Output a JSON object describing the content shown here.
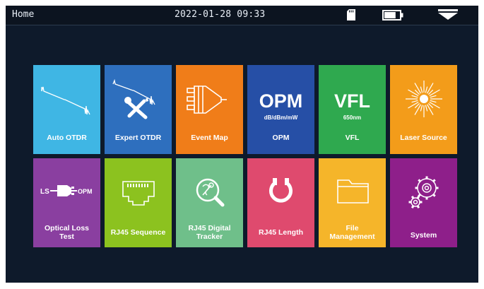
{
  "status_bar": {
    "title": "Home",
    "datetime": "2022-01-28 09:33",
    "icons": [
      "sd-card-icon",
      "battery-icon",
      "dropdown-icon"
    ],
    "battery_level": 0.75
  },
  "tiles_row1": [
    {
      "label": "Auto OTDR",
      "color": "#3fb6e4",
      "icon": "trace-icon"
    },
    {
      "label": "Expert OTDR",
      "color": "#2e6fbe",
      "icon": "tools-trace-icon"
    },
    {
      "label": "Event Map",
      "color": "#f07d19",
      "icon": "connector-icon"
    },
    {
      "label": "OPM",
      "color": "#264fa6",
      "icon_text": "OPM",
      "sub_text": "dB/dBm/mW"
    },
    {
      "label": "VFL",
      "color": "#2fa94f",
      "icon_text": "VFL",
      "sub_text": "650nm"
    },
    {
      "label": "Laser Source",
      "color": "#f39c1a",
      "icon": "laser-burst-icon"
    }
  ],
  "tiles_row2": [
    {
      "label": "Optical Loss\nTest",
      "color": "#8a3fa0",
      "icon": "ls-opm-icon",
      "icon_left": "LS",
      "icon_right": "OPM"
    },
    {
      "label": "RJ45 Sequence",
      "color": "#8cc21f",
      "icon": "rj45-port-icon"
    },
    {
      "label": "RJ45 Digital\nTracker",
      "color": "#6fbf8a",
      "icon": "magnifier-icon"
    },
    {
      "label": "RJ45 Length",
      "color": "#df4a6e",
      "icon": "cable-loop-icon"
    },
    {
      "label": "File\nManagement",
      "color": "#f5b52a",
      "icon": "folder-icon"
    },
    {
      "label": "System",
      "color": "#8e1f8a",
      "icon": "gears-icon"
    }
  ]
}
